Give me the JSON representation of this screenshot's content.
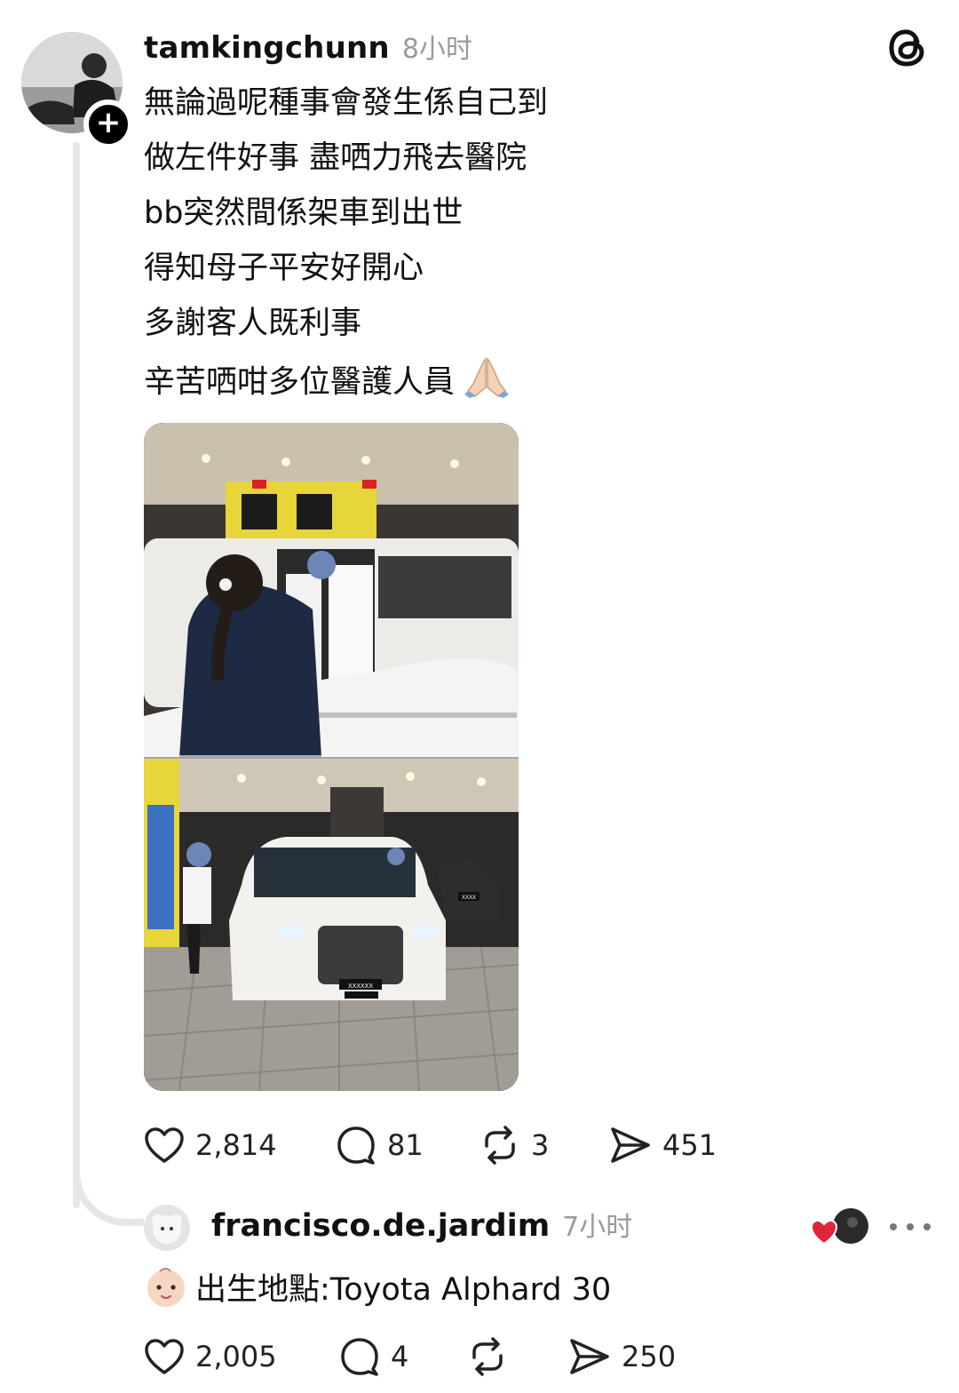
{
  "post": {
    "username": "tamkingchunn",
    "time": "8小时",
    "text_lines": [
      "無論過呢種事會發生係自己到",
      "做左件好事 盡哂力飛去醫院",
      "bb突然間係架車到出世",
      "得知母子平安好開心",
      "多謝客人既利事",
      "辛苦哂咁多位醫護人員"
    ],
    "last_line_emoji": "praying-hands-icon",
    "photo_plates": {
      "front": "XXXXXX",
      "side": "XXXX"
    },
    "actions": {
      "likes": "2,814",
      "replies": "81",
      "reposts": "3",
      "shares": "451"
    }
  },
  "reply": {
    "username": "francisco.de.jardim",
    "time": "7小时",
    "text": "出生地點:Toyota Alphard 30",
    "leading_emoji": "baby-face-icon",
    "actions": {
      "likes": "2,005",
      "replies": "4",
      "reposts": "",
      "shares": "250"
    }
  },
  "colors": {
    "text": "#111111",
    "muted": "#9a9a9a",
    "thread_line": "#e6e6e6",
    "like_red": "#e0243c"
  }
}
